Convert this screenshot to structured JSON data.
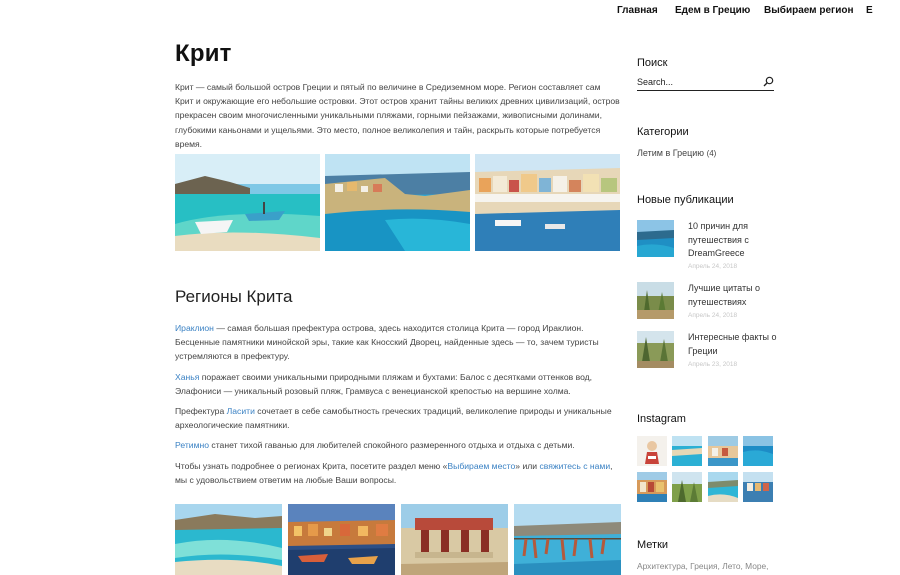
{
  "nav": {
    "items": [
      "Главная",
      "Едем в Грецию",
      "Выбираем регион",
      "Е"
    ]
  },
  "article": {
    "title": "Крит",
    "intro": "Крит — самый большой остров Греции и пятый по величине в Средиземном море. Регион составляет сам Крит и окружающие его небольшие островки. Этот остров хранит тайны великих древних цивилизаций, остров прекрасен своим многочисленными уникальными пляжами, горными пейзажами, живописными долинами, глубокими каньонами и ущельями. Это место, полное великолепия и тайн, раскрыть которые потребуется время.",
    "regions_heading": "Регионы Крита",
    "p1_link": "Ираклион",
    "p1_text": " — самая большая префектура острова, здесь находится столица Крита — город Ираклион. Бесценные памятники минойской эры, такие как Кносский Дворец, найденные здесь — то, зачем туристы устремляются в префектуру.",
    "p2_link": "Ханья",
    "p2_text": " поражает своими уникальными природными пляжам и бухтами: Балос с десятками оттенков вод, Элафониси — уникальный розовый пляж, Грамвуса с венецианской крепостью на вершине холма.",
    "p3_before": "Префектура ",
    "p3_link": "Ласити",
    "p3_text": " сочетает в себе самобытность греческих традиций, великолепие природы и уникальные археологические памятники.",
    "p4_link": "Ретимно",
    "p4_text": " станет тихой гаванью для любителей спокойного размеренного отдыха и отдыха с детьми.",
    "p5_before": "Чтобы узнать подробнее о регионах Крита, посетите раздел меню «",
    "p5_link1": "Выбираем место",
    "p5_mid": "» или ",
    "p5_link2": "свяжитесь с нами",
    "p5_after": ", мы с удовольствием ответим на любые Ваши вопросы."
  },
  "sidebar": {
    "search_title": "Поиск",
    "search_placeholder": "Search...",
    "categories_title": "Категории",
    "category": "Летим в Грецию",
    "category_count": "(4)",
    "recent_title": "Новые публикации",
    "posts": [
      {
        "title": "10 причин для путешествия с DreamGreece",
        "date": "Апрель 24, 2018"
      },
      {
        "title": "Лучшие цитаты о путешествиях",
        "date": "Апрель 24, 2018"
      },
      {
        "title": "Интересные факты о Греции",
        "date": "Апрель 23, 2018"
      }
    ],
    "instagram_title": "Instagram",
    "tags_title": "Метки",
    "tags": "Архитектура, Греция, Лето, Море,"
  },
  "colors": {
    "link": "#3b82c4",
    "sea": "#1fa3c8",
    "text": "#444444"
  },
  "icons": [
    "search-icon"
  ]
}
